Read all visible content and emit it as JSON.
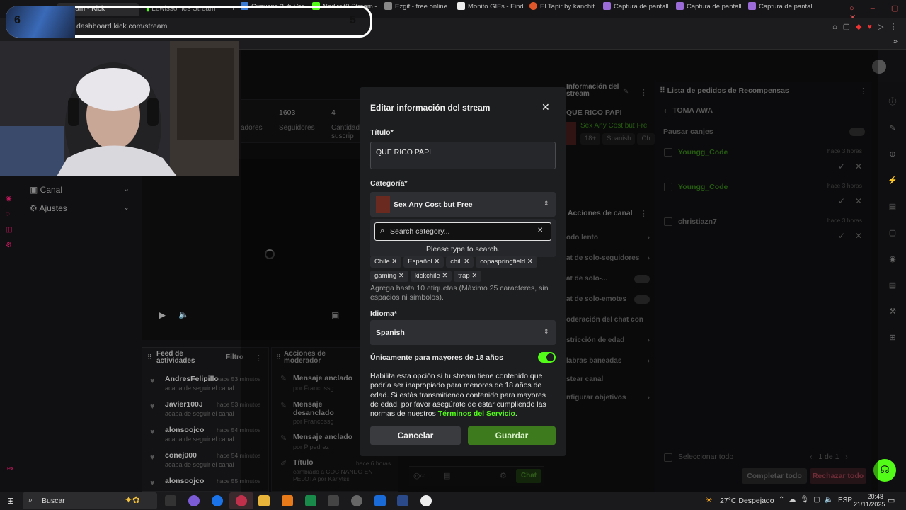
{
  "browser": {
    "tabs": [
      {
        "label": "Stream - Kick Dashboard",
        "active": true
      },
      {
        "label": "Lewissomes Stream -",
        "active": false
      }
    ],
    "url": "dashboard.kick.com/stream",
    "bookmarks": [
      "Cuevana 3 ⚜ Ver...",
      "Nadirclt0 Stream -...",
      "Ezgif - free online...",
      "Monito GIFs - Find...",
      "El Tapir by kanchit...",
      "Captura de pantall...",
      "Captura de pantall...",
      "Captura de pantall..."
    ]
  },
  "overlay": {
    "left_number": "6",
    "right_number": "5"
  },
  "dashboard": {
    "stats": [
      {
        "value": "1603",
        "label": "Seguidores"
      },
      {
        "value": "4",
        "label": "Cantidad suscrip"
      },
      {
        "value": "",
        "label": "adores"
      }
    ],
    "sidebar": [
      "Canal",
      "Ajustes"
    ],
    "feed": {
      "title": "Feed de actividades",
      "filter": "Filtro",
      "items": [
        {
          "name": "AndresFelipillo",
          "time": "hace 53 minutos",
          "action": "acaba de seguir el canal"
        },
        {
          "name": "Javier100J",
          "time": "hace 53 minutos",
          "action": "acaba de seguir el canal"
        },
        {
          "name": "alonsoojco",
          "time": "hace 54 minutos",
          "action": "acaba de seguir el canal"
        },
        {
          "name": "conej000",
          "time": "hace 54 minutos",
          "action": "acaba de seguir el canal"
        },
        {
          "name": "alonsoojco",
          "time": "hace 55 minutos",
          "action": ""
        }
      ]
    },
    "moderator": {
      "title": "Acciones de moderador",
      "items": [
        {
          "title": "Mensaje anclado",
          "by": "por Francossg"
        },
        {
          "title": "Mensaje desanclado",
          "by": "por Francossg"
        },
        {
          "title": "Mensaje anclado",
          "by": "por Pipedrez"
        },
        {
          "title": "Título",
          "time": "hace 6 horas",
          "by": "cambiado a COCINANDO EN PELOTA por Karlytss"
        }
      ]
    },
    "stream_info": {
      "title": "Información del stream",
      "stream_title": "QUE RICO PAPI",
      "category": "Sex Any Cost but Fre",
      "tags": [
        "18+",
        "Spanish",
        "Ch"
      ]
    },
    "channel_actions": {
      "title": "Acciones de canal",
      "items": [
        "odo lento",
        "at de solo-seguidores",
        "at de solo-...",
        "at de solo-emotes",
        "oderación del chat con",
        "stricción de edad",
        "labras baneadas",
        "stear canal",
        "nfigurar objetivos"
      ]
    },
    "chat_button": "Chat",
    "rewards": {
      "title": "Lista de pedidos de Recompensas",
      "reward": "TOMA AWA",
      "pause": "Pausar canjes",
      "requests": [
        {
          "user": "Youngg_Code",
          "time": "hace 3 horas"
        },
        {
          "user": "Youngg_Code",
          "time": "hace 3 horas"
        },
        {
          "user": "christiazn7",
          "time": "hace 3 horas"
        }
      ],
      "select_all": "Seleccionar todo",
      "pagination": "1 de 1",
      "complete_all": "Completar todo",
      "reject_all": "Rechazar todo"
    }
  },
  "modal": {
    "title": "Editar información del stream",
    "title_label": "Título*",
    "title_value": "QUE RICO PAPI",
    "category_label": "Categoría*",
    "category_value": "Sex Any Cost but Free",
    "search_placeholder": "Search category...",
    "search_hint": "Please type to search.",
    "tags": [
      "Chile",
      "Español",
      "chill",
      "copaspringfield",
      "gaming",
      "kickchile",
      "trap"
    ],
    "tags_help": "Agrega hasta 10 etiquetas (Máximo 25 caracteres, sin espacios ni símbolos).",
    "language_label": "Idioma*",
    "language_value": "Spanish",
    "mature_label": "Únicamente para mayores de 18 años",
    "mature_on": true,
    "mature_help": "Habilita esta opción si tu stream tiene contenido que podría ser inapropiado para menores de 18 años de edad. Si estás transmitiendo contenido para mayores de edad, por favor asegúrate de estar cumpliendo las normas de nuestros",
    "terms_link": "Términos del Servicio",
    "cancel": "Cancelar",
    "save": "Guardar"
  },
  "taskbar": {
    "search": "Buscar",
    "weather": "27°C  Despejado",
    "lang": "ESP",
    "time": "20:48",
    "date": "21/11/2025"
  },
  "colors": {
    "accent": "#53fc18",
    "save_bg": "#3d7a1e"
  }
}
